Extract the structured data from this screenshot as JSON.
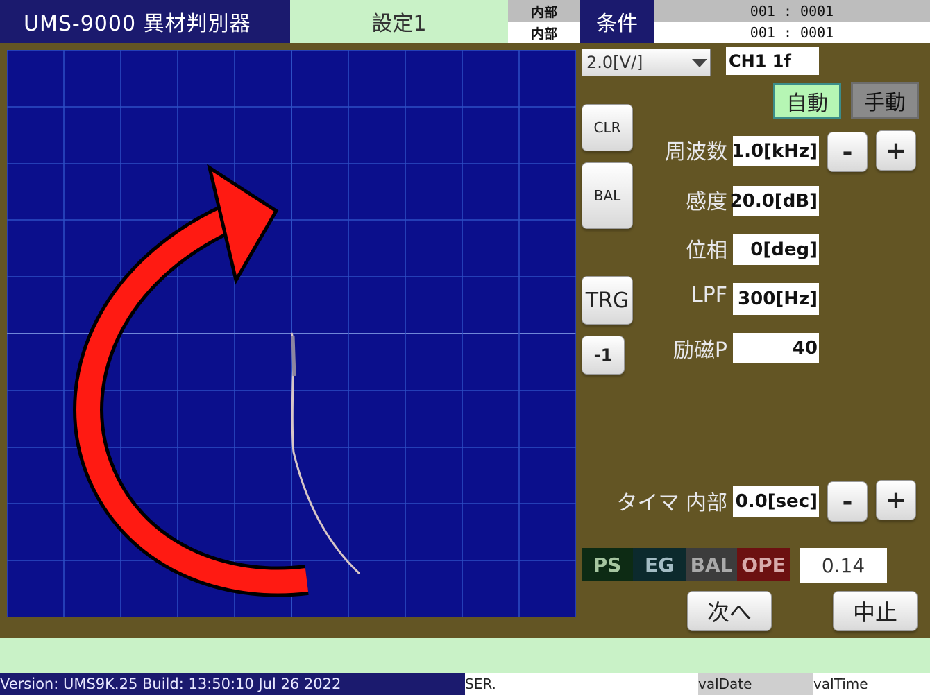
{
  "header": {
    "app_title": "UMS-9000 異材判別器",
    "setting_tab": "設定1",
    "mode_top": "内部",
    "mode_bottom": "内部",
    "condition_label": "条件",
    "counter_top": "001 : 0001",
    "counter_bottom": "001 : 0001"
  },
  "scope": {
    "background_color": "#0b0f8c",
    "grid_color": "#2d4fc4",
    "trace_color": "#d7c6c6",
    "arrow_color": "#ff1a12",
    "arrow_icon": "rotate-clockwise-arrow-icon"
  },
  "controls": {
    "volt_select": "2.0[V/]",
    "channel": "CH1 1f",
    "auto_label": "自動",
    "manual_label": "手動",
    "clr_label": "CLR",
    "bal_label": "BAL",
    "trg_label": "TRG",
    "minus_one_label": "-1",
    "minus_label": "-",
    "plus_label": "+",
    "next_label": "次へ",
    "stop_label": "中止"
  },
  "params": {
    "frequency": {
      "label": "周波数",
      "value": "1.0[kHz]"
    },
    "sensitivity": {
      "label": "感度",
      "value": "20.0[dB]"
    },
    "phase": {
      "label": "位相",
      "value": "0[deg]"
    },
    "lpf": {
      "label": "LPF",
      "value": "300[Hz]"
    },
    "excitation": {
      "label": "励磁P",
      "value": "40"
    },
    "timer": {
      "label": "タイマ 内部",
      "value": "0.0[sec]"
    }
  },
  "status": {
    "ps": "PS",
    "eg": "EG",
    "bal": "BAL",
    "ope": "OPE",
    "value": "0.14"
  },
  "footer": {
    "version": "Version: UMS9K.25 Build: 13:50:10 Jul 26 2022",
    "ser": "SER.",
    "val_date": "valDate",
    "val_time": "valTime"
  }
}
